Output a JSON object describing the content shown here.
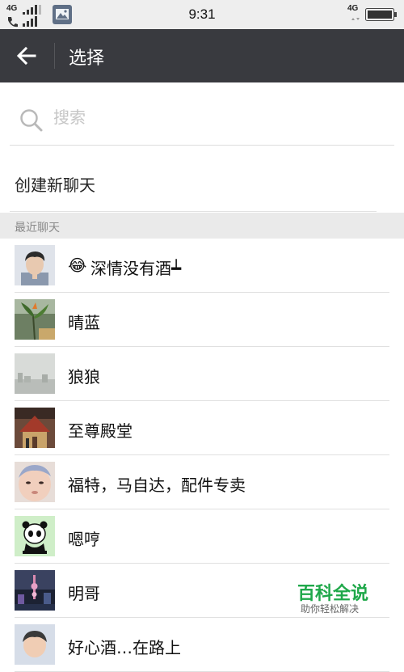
{
  "status_bar": {
    "time": "9:31",
    "network_left": "4G",
    "network_right": "4G",
    "icons": [
      "signal-icon",
      "call-icon",
      "gallery-notification-icon",
      "battery-icon"
    ]
  },
  "app_bar": {
    "title": "选择",
    "back_icon": "arrow-left-icon",
    "background": "#393a3f"
  },
  "search": {
    "placeholder": "搜索",
    "value": ""
  },
  "new_chat_label": "创建新聊天",
  "recent_header": "最近聊天",
  "recent_chats": [
    {
      "name": "深情没有酒┷",
      "emoji": "😂",
      "avatar": "young-man-photo"
    },
    {
      "name": "晴蓝",
      "avatar": "plant-photo"
    },
    {
      "name": "狼狼",
      "avatar": "foggy-city-photo"
    },
    {
      "name": "至尊殿堂",
      "avatar": "temple-photo"
    },
    {
      "name": "福特，马自达，配件专卖",
      "avatar": "baby-photo"
    },
    {
      "name": "嗯哼",
      "avatar": "panda-cartoon"
    },
    {
      "name": "明哥",
      "avatar": "city-night-photo"
    },
    {
      "name": "好心酒…在路上",
      "avatar": "child-photo"
    }
  ],
  "watermark": {
    "title": "百科全说",
    "subtitle": "助你轻松解决"
  },
  "colors": {
    "accent_green": "#1fa84a",
    "divider": "#e0e0e0",
    "section_bg": "#eaeaea"
  }
}
